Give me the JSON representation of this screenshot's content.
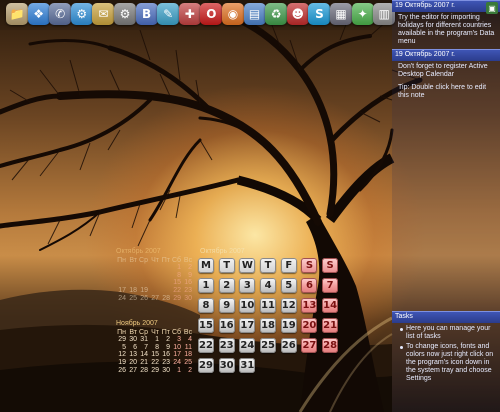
{
  "dock": {
    "icons": [
      {
        "name": "file-icon",
        "glyph": "📁",
        "color": "#b8a070"
      },
      {
        "name": "windows-icon",
        "glyph": "❖",
        "color": "#2f7fd8"
      },
      {
        "name": "phone-icon",
        "glyph": "✆",
        "color": "#5a6d9a"
      },
      {
        "name": "network-icon",
        "glyph": "⚙",
        "color": "#2e8fd8"
      },
      {
        "name": "folder-icon",
        "glyph": "✉",
        "color": "#c9a23c"
      },
      {
        "name": "settings-icon",
        "glyph": "⚙",
        "color": "#7a7a7a"
      },
      {
        "name": "chart-icon",
        "glyph": "B",
        "color": "#4a6dc0"
      },
      {
        "name": "pencil-icon",
        "glyph": "✎",
        "color": "#3aa0c8"
      },
      {
        "name": "tools-icon",
        "glyph": "✚",
        "color": "#c04040"
      },
      {
        "name": "opera-icon",
        "glyph": "O",
        "color": "#cc1a1a"
      },
      {
        "name": "browser-icon",
        "glyph": "◉",
        "color": "#e07020"
      },
      {
        "name": "clipboard-icon",
        "glyph": "▤",
        "color": "#4a80c8"
      },
      {
        "name": "recycle-bin-icon",
        "glyph": "♻",
        "color": "#3f9a4a"
      },
      {
        "name": "game-icon",
        "glyph": "☻",
        "color": "#c02a2a"
      },
      {
        "name": "skype-icon",
        "glyph": "S",
        "color": "#1a9ad8"
      },
      {
        "name": "printer-icon",
        "glyph": "▦",
        "color": "#6a6a7a"
      },
      {
        "name": "robot-icon",
        "glyph": "✦",
        "color": "#4ab04a"
      },
      {
        "name": "trash-icon",
        "glyph": "▥",
        "color": "#8a8a8a"
      }
    ]
  },
  "notes": {
    "items": [
      {
        "date": "19 Октябрь 2007 г.",
        "text": "Try the editor for importing holidays for different countries available in the program's Data menu"
      },
      {
        "date": "19 Октябрь 2007 г.",
        "text": "Don't forget to register Active Desktop Calendar"
      },
      {
        "date": "",
        "text": "Tip: Double click here to edit this note"
      }
    ],
    "tasks_title": "Tasks",
    "tasks": [
      "Here you can manage your list of tasks",
      "To change icons, fonts and colors now just right click on the program's icon down in the system tray and choose Settings"
    ]
  },
  "calendars": {
    "october_small": {
      "title": "Октябрь 2007",
      "headers": [
        "Пн",
        "Вт",
        "Ср",
        "Чт",
        "Пт",
        "Сб",
        "Вс"
      ],
      "rows": [
        [
          "",
          "",
          "",
          "",
          "",
          "1",
          "2"
        ],
        [
          "",
          "",
          "",
          "",
          "",
          "8",
          "9"
        ],
        [
          "",
          "",
          "",
          "",
          "",
          "15",
          "16"
        ],
        [
          "17",
          "18",
          "19",
          "",
          "",
          "22",
          "23"
        ],
        [
          "24",
          "25",
          "26",
          "27",
          "28",
          "29",
          "30"
        ]
      ]
    },
    "november": {
      "title": "Ноябрь 2007",
      "headers": [
        "Пн",
        "Вт",
        "Ср",
        "Чт",
        "Пт",
        "Сб",
        "Вс"
      ],
      "rows": [
        [
          "29",
          "30",
          "31",
          "1",
          "2",
          "3",
          "4"
        ],
        [
          "5",
          "6",
          "7",
          "8",
          "9",
          "10",
          "11"
        ],
        [
          "12",
          "13",
          "14",
          "15",
          "16",
          "17",
          "18"
        ],
        [
          "19",
          "20",
          "21",
          "22",
          "23",
          "24",
          "25"
        ],
        [
          "26",
          "27",
          "28",
          "29",
          "30",
          "1",
          "2"
        ]
      ]
    },
    "main": {
      "title": "Октябрь 2007",
      "headers": [
        "M",
        "T",
        "W",
        "T",
        "F",
        "S",
        "S"
      ],
      "rows": [
        [
          "1",
          "2",
          "3",
          "4",
          "5",
          "6",
          "7"
        ],
        [
          "8",
          "9",
          "10",
          "11",
          "12",
          "13",
          "14"
        ],
        [
          "15",
          "16",
          "17",
          "18",
          "19",
          "20",
          "21"
        ],
        [
          "22",
          "23",
          "24",
          "25",
          "26",
          "27",
          "28"
        ],
        [
          "29",
          "30",
          "31",
          "",
          "",
          "",
          ""
        ]
      ]
    }
  }
}
